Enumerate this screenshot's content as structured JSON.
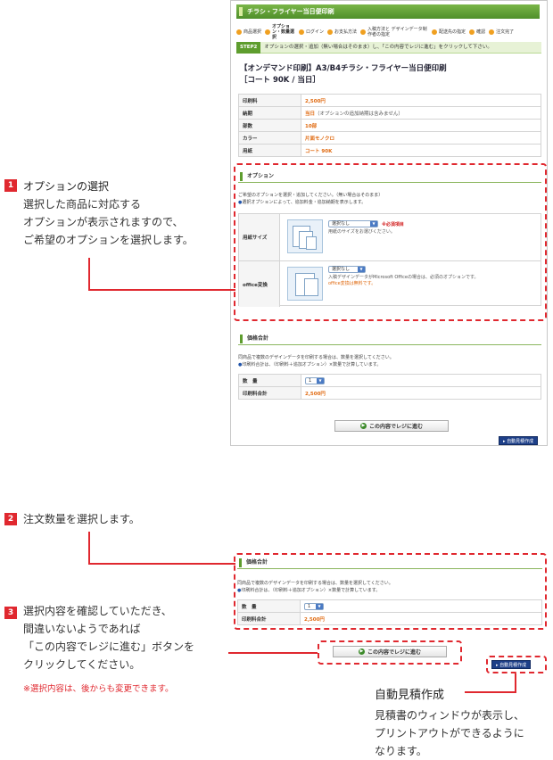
{
  "screen": {
    "header_title": "チラシ・フライヤー当日便印刷",
    "steps": [
      "商品選択",
      "オプション・数量選択",
      "ログイン",
      "お支払方法",
      "入稿方法と デザインデータ制作者の指定",
      "配送先の指定",
      "確認",
      "注文完了"
    ],
    "step_tag": "STEP2",
    "step_instruction": "オプションの選択・追加（無い場合はそのまま）し、「この内容でレジに進む」をクリックして下さい。",
    "product_title_1": "【オンデマンド印刷】A3/B4チラシ・フライヤー当日便印刷",
    "product_title_2": "［コート 90K / 当日］",
    "spec": [
      {
        "label": "印刷料",
        "value": "2,500円",
        "note": ""
      },
      {
        "label": "納期",
        "value": "当日",
        "note": "（オプションの追加納期は含みません）"
      },
      {
        "label": "部数",
        "value": "10部",
        "note": ""
      },
      {
        "label": "カラー",
        "value": "片面モノクロ",
        "note": ""
      },
      {
        "label": "用紙",
        "value": "コート 90K",
        "note": ""
      }
    ],
    "option_heading": "オプション",
    "option_desc_1": "ご希望のオプションを選択・追加してください。（無い場合はそのまま）",
    "option_desc_2": "選択オプションによって、追加料金・追加納期を表示します。",
    "options": [
      {
        "label": "用紙サイズ",
        "select": "選択なし",
        "required": "※必須項目",
        "hint": "用紙のサイズをお選びください。",
        "hint2": ""
      },
      {
        "label": "office変換",
        "select": "選択なし",
        "required": "",
        "hint": "入稿デザインデータがMicrosoft Officeの場合は、必須のオプションです。",
        "hint2": "office変換は無料です。"
      }
    ],
    "price_heading": "価格合計",
    "price_desc_1": "同商品で複数のデザインデータを印刷する場合は、数量を選択してください。",
    "price_desc_2": "印刷料合計は、（印刷料＋追加オプション）×数量で計算しています。",
    "qty_label": "数　量",
    "qty_value": "1",
    "total_label": "印刷料合計",
    "total_value": "2,500円",
    "checkout_button": "この内容でレジに進む",
    "auto_estimate_button": "自動見積作成"
  },
  "annotations": {
    "n1": "1",
    "n1_title": "オプションの選択",
    "n1_lines": [
      "選択した商品に対応する",
      "オプションが表示されますので、",
      "ご希望のオプションを選択します。"
    ],
    "n2": "2",
    "n2_text": "注文数量を選択します。",
    "n3": "3",
    "n3_lines": [
      "選択内容を確認していただき、",
      "間違いないようであれば",
      "「この内容でレジに進む」ボタンを",
      "クリックしてください。"
    ],
    "n3_note": "※選択内容は、後からも変更できます。",
    "auto_title": "自動見積作成",
    "auto_lines": [
      "見積書のウィンドウが表示し、",
      "プリントアウトができるように",
      "なります。"
    ]
  }
}
